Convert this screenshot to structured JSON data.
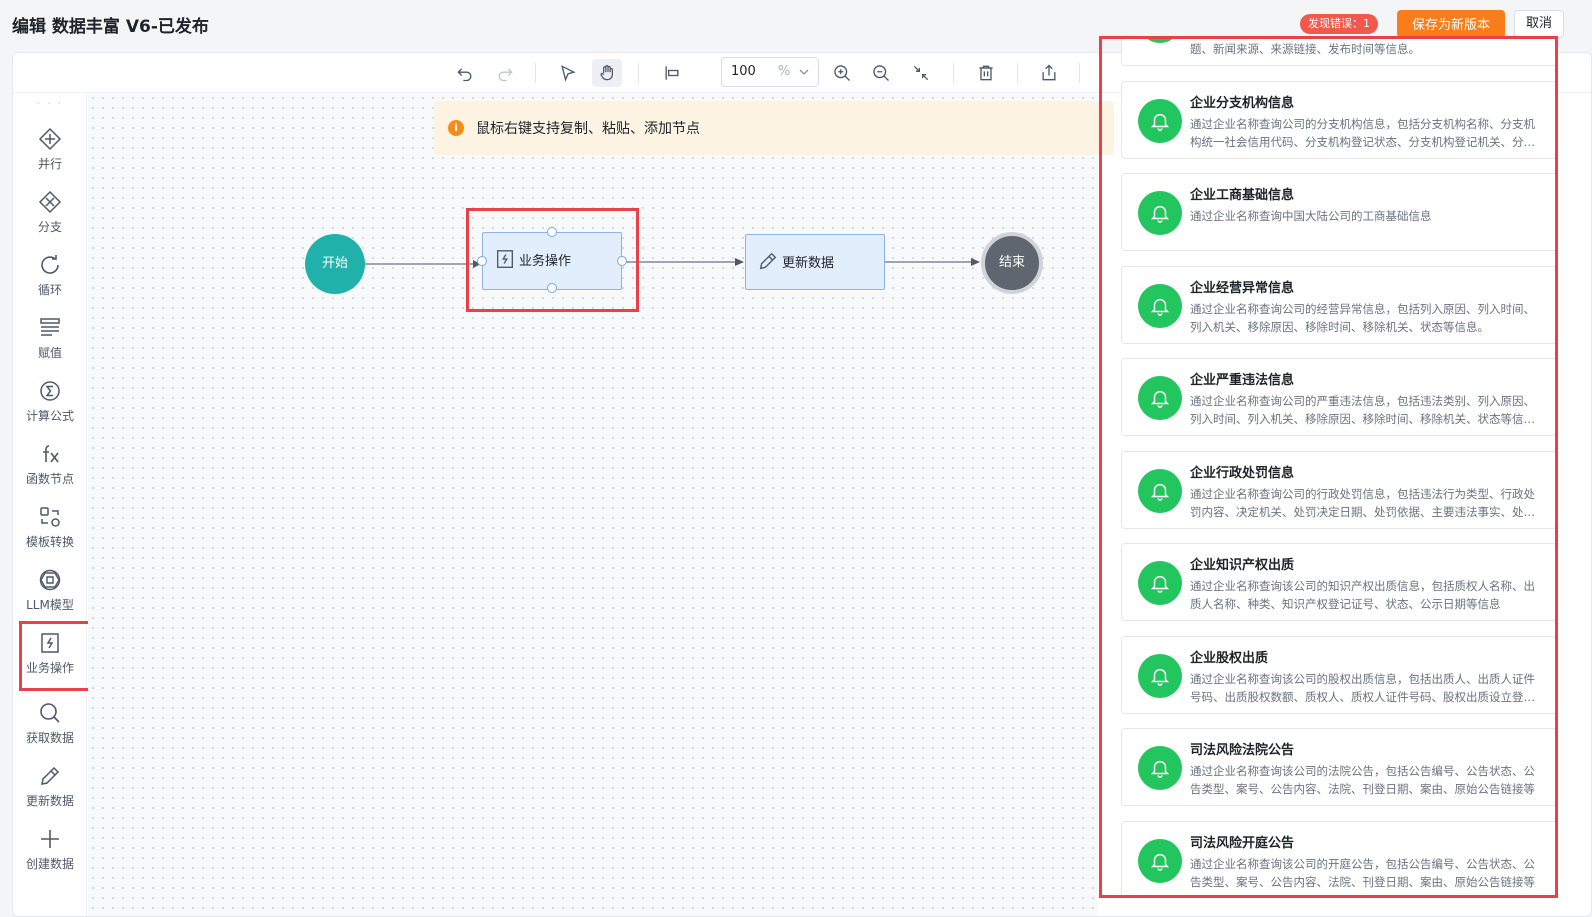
{
  "header": {
    "title": "编辑 数据丰富 V6-已发布",
    "error_badge": "发现错误：1",
    "save_label": "保存为新版本",
    "cancel_label": "取消"
  },
  "toolbar": {
    "zoom_value": "100",
    "zoom_unit": "%",
    "icons": [
      "undo-icon",
      "redo-icon",
      "select-pointer-icon",
      "hand-pan-icon",
      "align-left-icon",
      "zoom-in-icon",
      "zoom-out-icon",
      "fit-view-icon",
      "delete-icon",
      "export-icon"
    ]
  },
  "palette": {
    "items": [
      {
        "label": "并行",
        "icon": "parallel-icon"
      },
      {
        "label": "分支",
        "icon": "branch-icon"
      },
      {
        "label": "循环",
        "icon": "loop-icon"
      },
      {
        "label": "赋值",
        "icon": "assign-icon"
      },
      {
        "label": "计算公式",
        "icon": "formula-sigma-icon"
      },
      {
        "label": "函数节点",
        "icon": "function-fx-icon"
      },
      {
        "label": "模板转换",
        "icon": "template-transform-icon"
      },
      {
        "label": "LLM模型",
        "icon": "llm-model-icon"
      },
      {
        "label": "业务操作",
        "icon": "business-operation-icon"
      },
      {
        "label": "获取数据",
        "icon": "search-data-icon"
      },
      {
        "label": "更新数据",
        "icon": "edit-pencil-icon"
      },
      {
        "label": "创建数据",
        "icon": "plus-icon"
      }
    ]
  },
  "canvas": {
    "tip": "鼠标右键支持复制、粘贴、添加节点",
    "nodes": {
      "start": "开始",
      "business": "业务操作",
      "update": "更新数据",
      "end": "结束"
    }
  },
  "panel": {
    "partial_card_desc": "题、新闻来源、来源链接、发布时间等信息。",
    "cards": [
      {
        "title": "企业分支机构信息",
        "desc": "通过企业名称查询公司的分支机构信息，包括分支机构名称、分支机构统一社会信用代码、分支机构登记状态、分支机构登记机关、分…"
      },
      {
        "title": "企业工商基础信息",
        "desc": "通过企业名称查询中国大陆公司的工商基础信息"
      },
      {
        "title": "企业经营异常信息",
        "desc": "通过企业名称查询公司的经营异常信息，包括列入原因、列入时间、列入机关、移除原因、移除时间、移除机关、状态等信息。"
      },
      {
        "title": "企业严重违法信息",
        "desc": "通过企业名称查询公司的严重违法信息，包括违法类别、列入原因、列入时间、列入机关、移除原因、移除时间、移除机关、状态等信…"
      },
      {
        "title": "企业行政处罚信息",
        "desc": "通过企业名称查询公司的行政处罚信息，包括违法行为类型、行政处罚内容、决定机关、处罚决定日期、处罚依据、主要违法事实、处…"
      },
      {
        "title": "企业知识产权出质",
        "desc": "通过企业名称查询该公司的知识产权出质信息，包括质权人名称、出质人名称、种类、知识产权登记证号、状态、公示日期等信息"
      },
      {
        "title": "企业股权出质",
        "desc": "通过企业名称查询该公司的股权出质信息，包括出质人、出质人证件号码、出质股权数额、质权人、质权人证件号码、股权出质设立登…"
      },
      {
        "title": "司法风险法院公告",
        "desc": "通过企业名称查询该公司的法院公告，包括公告编号、公告状态、公告类型、案号、公告内容、法院、刊登日期、案由、原始公告链接等"
      },
      {
        "title": "司法风险开庭公告",
        "desc": "通过企业名称查询该公司的开庭公告，包括公告编号、公告状态、公告类型、案号、公告内容、法院、刊登日期、案由、原始公告链接等"
      }
    ]
  },
  "colors": {
    "accent_orange": "#fa7d1a",
    "error_red": "#f5574a",
    "highlight_red": "#e8414a",
    "start_teal": "#20b2aa",
    "bell_green": "#22c55e"
  }
}
